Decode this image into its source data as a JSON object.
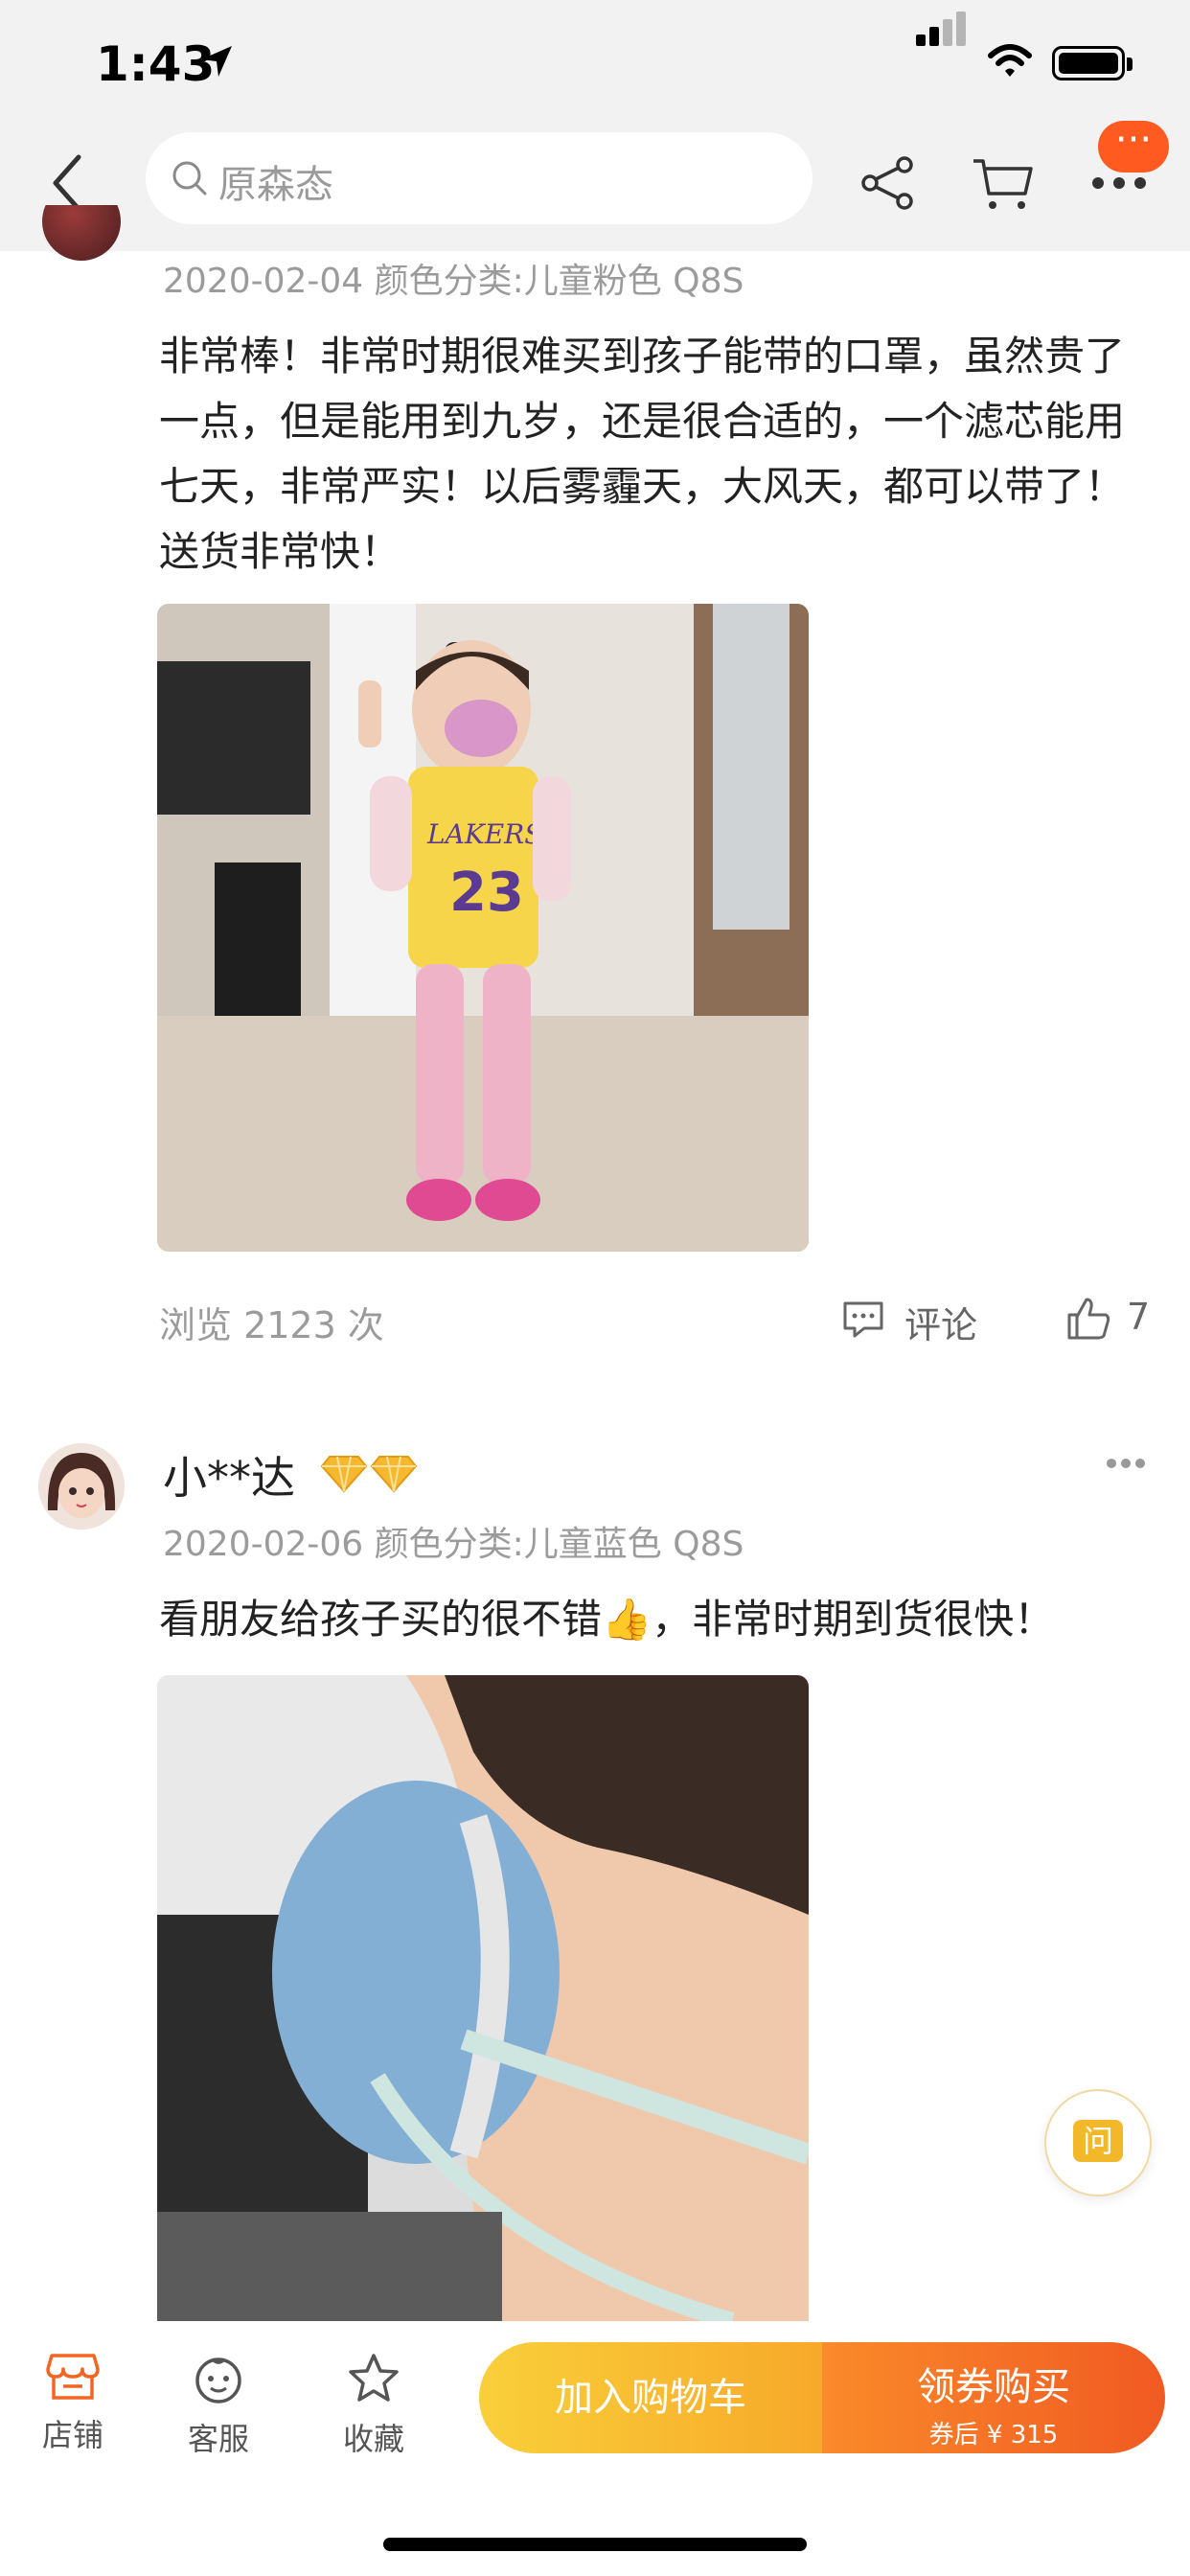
{
  "status_bar": {
    "time": "1:43"
  },
  "nav": {
    "search_placeholder": "原森态",
    "badge": "···"
  },
  "review1": {
    "meta": "2020-02-04 颜色分类:儿童粉色 Q8S",
    "text": "非常棒！非常时期很难买到孩子能带的口罩，虽然贵了一点，但是能用到九岁，还是很合适的，一个滤芯能用七天，非常严实！以后雾霾天，大风天，都可以带了！送货非常快！",
    "jersey_brand": "LAKERS",
    "jersey_number": "23",
    "views": "浏览 2123 次",
    "comment_label": "评论",
    "likes": "7"
  },
  "review2": {
    "username": "小**达",
    "meta": "2020-02-06 颜色分类:儿童蓝色 Q8S",
    "text": "看朋友给孩子买的很不错👍，非常时期到货很快！"
  },
  "ask_button": {
    "label": "问"
  },
  "bottom_bar": {
    "tabs": [
      {
        "label": "店铺"
      },
      {
        "label": "客服"
      },
      {
        "label": "收藏"
      }
    ],
    "add_cart_label": "加入购物车",
    "buy_label": "领券购买",
    "buy_sub": "券后 ¥ 315"
  },
  "colors": {
    "accent": "#ff5a1f",
    "cart_button": "#f9cf3a",
    "buy_button": "#f05a22"
  }
}
